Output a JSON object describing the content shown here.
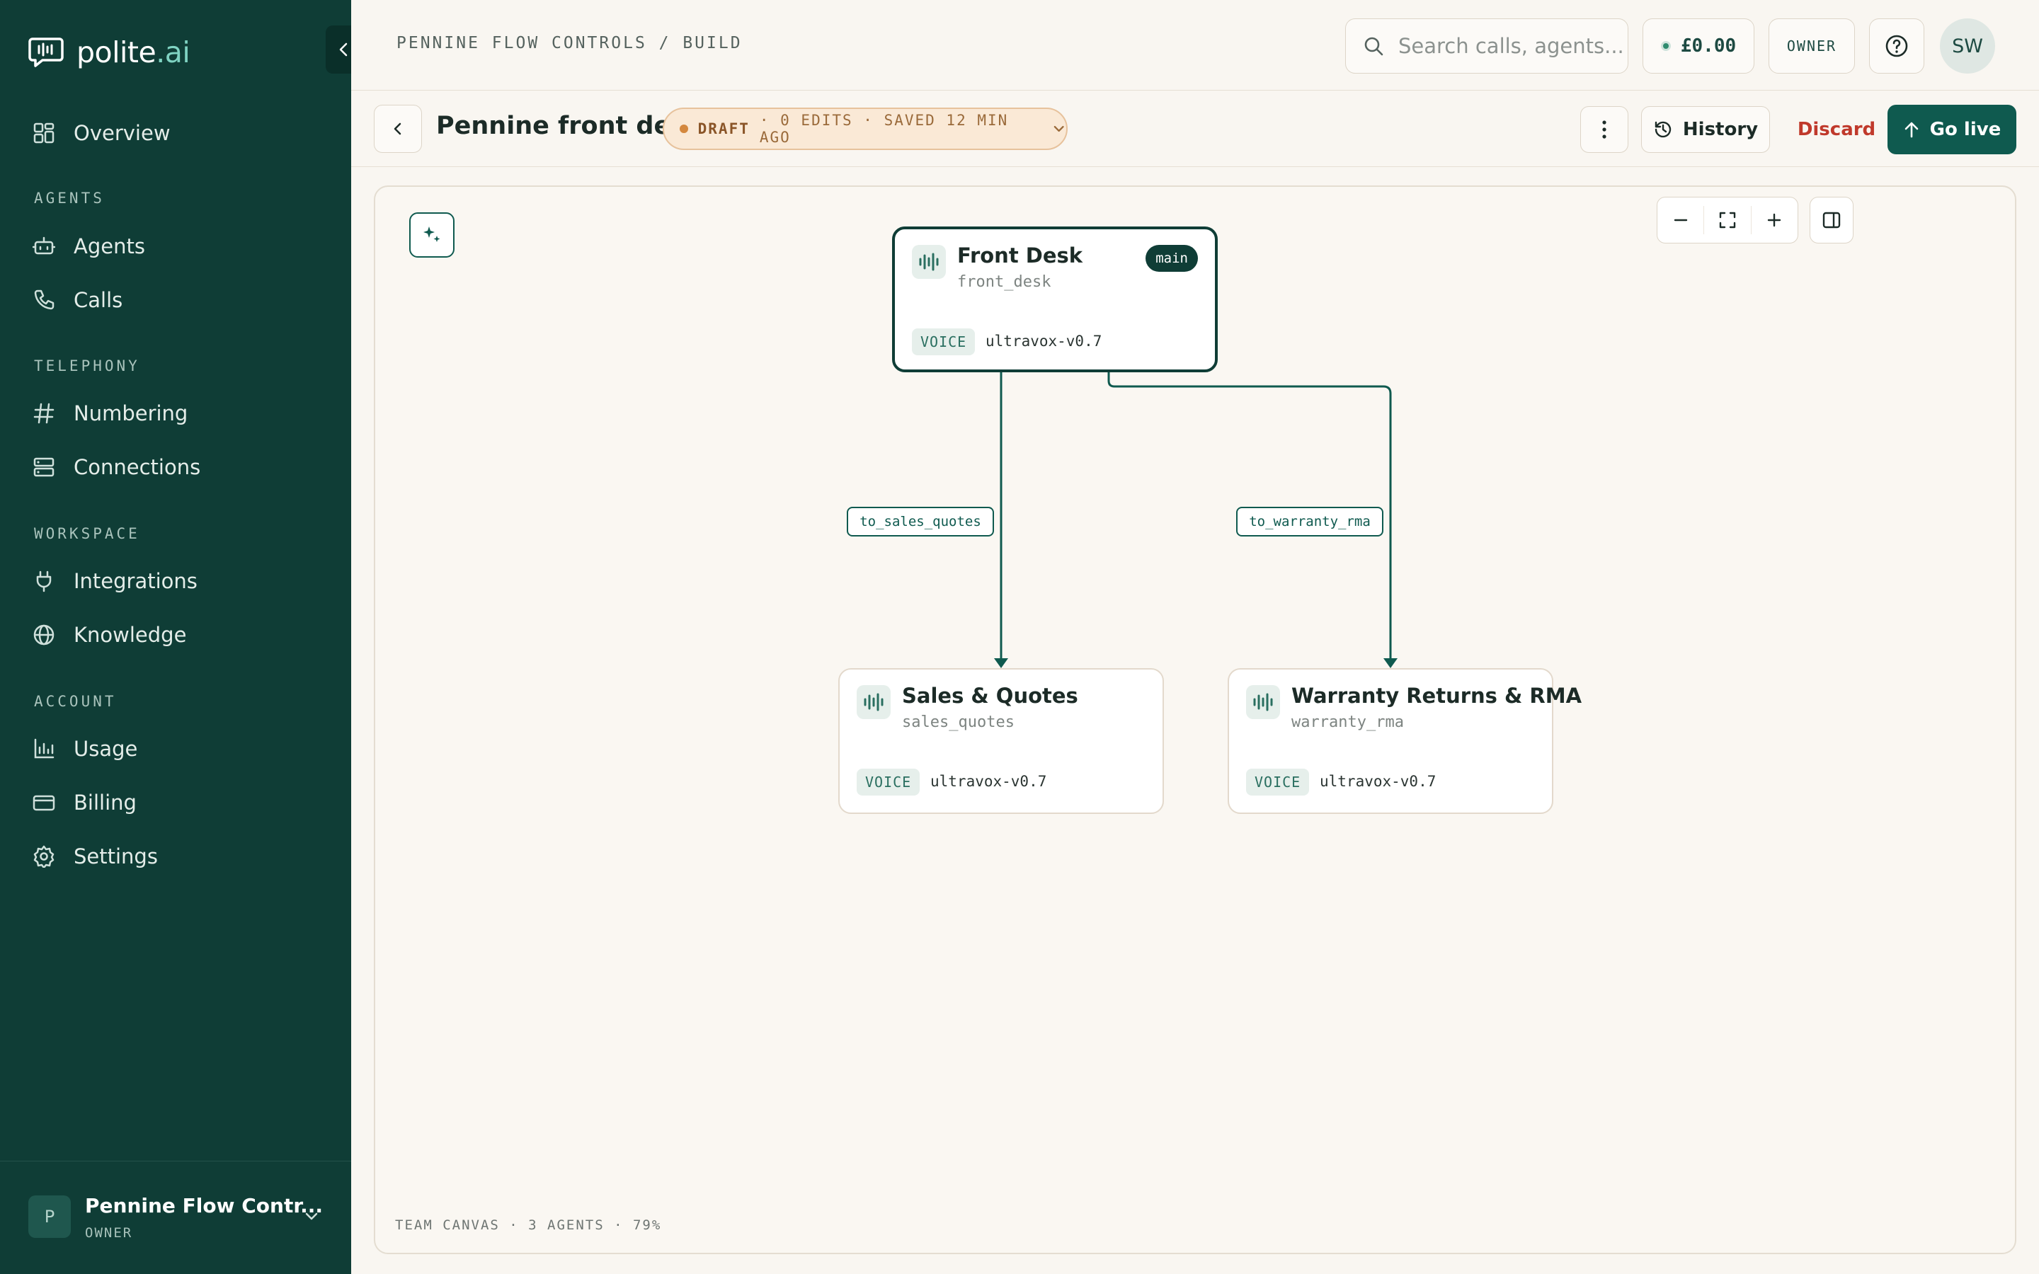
{
  "brand": {
    "name_main": "polite",
    "name_accent": ".ai"
  },
  "sidebar": {
    "items_top": [
      {
        "label": "Overview",
        "icon": "grid-icon"
      }
    ],
    "sections": [
      {
        "title": "AGENTS",
        "items": [
          {
            "label": "Agents",
            "icon": "robot-icon"
          },
          {
            "label": "Calls",
            "icon": "phone-icon"
          }
        ]
      },
      {
        "title": "TELEPHONY",
        "items": [
          {
            "label": "Numbering",
            "icon": "hash-icon"
          },
          {
            "label": "Connections",
            "icon": "server-icon"
          }
        ]
      },
      {
        "title": "WORKSPACE",
        "items": [
          {
            "label": "Integrations",
            "icon": "plug-icon"
          },
          {
            "label": "Knowledge",
            "icon": "globe-icon"
          }
        ]
      },
      {
        "title": "ACCOUNT",
        "items": [
          {
            "label": "Usage",
            "icon": "bar-chart-icon"
          },
          {
            "label": "Billing",
            "icon": "credit-card-icon"
          },
          {
            "label": "Settings",
            "icon": "gear-icon"
          }
        ]
      }
    ],
    "org": {
      "initial": "P",
      "name": "Pennine Flow Contr...",
      "role": "OWNER"
    }
  },
  "topbar": {
    "breadcrumb": "PENNINE FLOW CONTROLS / BUILD",
    "search_placeholder": "Search calls, agents...",
    "balance": "£0.00",
    "role": "OWNER",
    "user_initials": "SW"
  },
  "subbar": {
    "title": "Pennine front desk",
    "draft_status": "DRAFT",
    "draft_meta": "· 0 EDITS · SAVED 12 MIN AGO",
    "history_label": "History",
    "discard_label": "Discard",
    "golive_label": "Go live"
  },
  "canvas": {
    "nodes": [
      {
        "title": "Front Desk",
        "slug": "front_desk",
        "tag": "main",
        "voice_label": "VOICE",
        "model": "ultravox-v0.7"
      },
      {
        "title": "Sales & Quotes",
        "slug": "sales_quotes",
        "voice_label": "VOICE",
        "model": "ultravox-v0.7"
      },
      {
        "title": "Warranty Returns & RMA",
        "slug": "warranty_rma",
        "voice_label": "VOICE",
        "model": "ultravox-v0.7"
      }
    ],
    "edges": [
      {
        "label": "to_sales_quotes"
      },
      {
        "label": "to_warranty_rma"
      }
    ],
    "footer": "TEAM CANVAS · 3 AGENTS · 79%"
  },
  "colors": {
    "sidebar_bg": "#0f3d36",
    "accent": "#0f5a4f",
    "danger": "#c0392b",
    "draft_bg": "#fae9d6"
  }
}
